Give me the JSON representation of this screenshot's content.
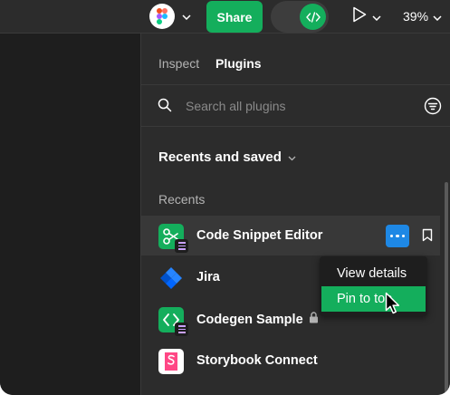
{
  "toolbar": {
    "share_label": "Share",
    "zoom_label": "39%",
    "accent": "#14ae5c"
  },
  "panel": {
    "tabs": [
      {
        "label": "Inspect",
        "active": false
      },
      {
        "label": "Plugins",
        "active": true
      }
    ],
    "search": {
      "placeholder": "Search all plugins",
      "value": ""
    },
    "section_title": "Recents and saved",
    "recents_label": "Recents",
    "plugins": [
      {
        "name": "Code Snippet Editor",
        "icon": "scissors-icon",
        "hovered": true,
        "locked": false
      },
      {
        "name": "Jira",
        "icon": "jira-icon",
        "hovered": false,
        "locked": false
      },
      {
        "name": "Codegen Sample",
        "icon": "code-brackets-icon",
        "hovered": false,
        "locked": true
      },
      {
        "name": "Storybook Connect",
        "icon": "storybook-icon",
        "hovered": false,
        "locked": false
      }
    ]
  },
  "context_menu": {
    "items": [
      {
        "label": "View details",
        "highlighted": false
      },
      {
        "label": "Pin to top",
        "highlighted": true
      }
    ]
  }
}
